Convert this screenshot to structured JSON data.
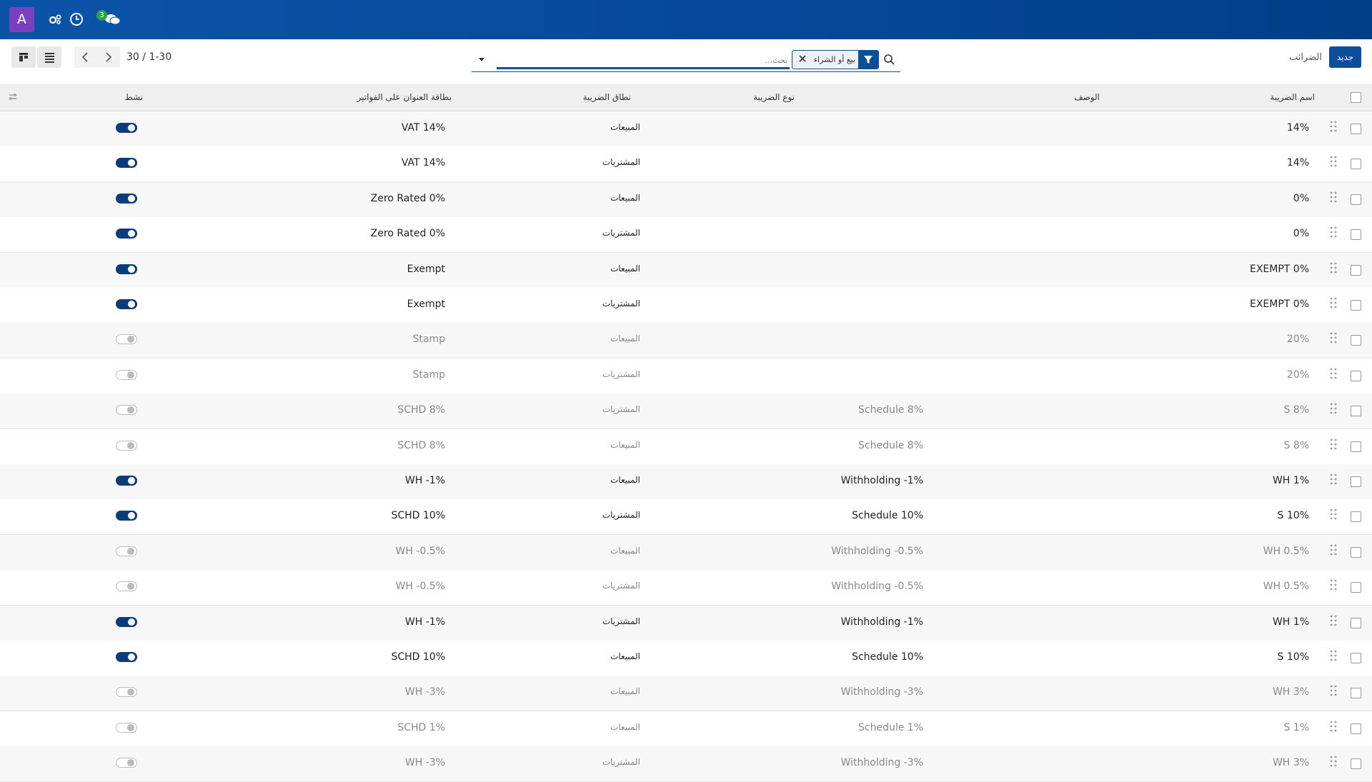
{
  "navbar": {
    "avatar_letter": "A",
    "messages_count": "3"
  },
  "control_panel": {
    "new_button": "جديد",
    "breadcrumb": "الضرائب",
    "facet_label": "بيع أو الشراء",
    "search_placeholder": "بحث...",
    "pager": "1-30 / 30"
  },
  "columns": {
    "name": "اسم الضريبة",
    "description": "الوصف",
    "type": "نوع الضريبة",
    "scope": "نطاق الضريبة",
    "invoice_label": "بطاقة العنوان على الفواتير",
    "active": "نشط"
  },
  "rows": [
    {
      "name": "14%",
      "description": "",
      "type": "المبيعات",
      "label": "VAT 14%",
      "active": true
    },
    {
      "name": "14%",
      "description": "",
      "type": "المشتريات",
      "label": "VAT 14%",
      "active": true
    },
    {
      "name": "0%",
      "description": "",
      "type": "المبيعات",
      "label": "Zero Rated 0%",
      "active": true
    },
    {
      "name": "0%",
      "description": "",
      "type": "المشتريات",
      "label": "Zero Rated 0%",
      "active": true
    },
    {
      "name": "EXEMPT 0%",
      "description": "",
      "type": "المبيعات",
      "label": "Exempt",
      "active": true
    },
    {
      "name": "EXEMPT 0%",
      "description": "",
      "type": "المشتريات",
      "label": "Exempt",
      "active": true
    },
    {
      "name": "20%",
      "description": "",
      "type": "المبيعات",
      "label": "Stamp",
      "active": false
    },
    {
      "name": "20%",
      "description": "",
      "type": "المشتريات",
      "label": "Stamp",
      "active": false
    },
    {
      "name": "S 8%",
      "description": "Schedule 8%",
      "type": "المشتريات",
      "label": "SCHD 8%",
      "active": false
    },
    {
      "name": "S 8%",
      "description": "Schedule 8%",
      "type": "المبيعات",
      "label": "SCHD 8%",
      "active": false
    },
    {
      "name": "WH 1%",
      "description": "Withholding -1%",
      "type": "المبيعات",
      "label": "WH -1%",
      "active": true
    },
    {
      "name": "S 10%",
      "description": "Schedule 10%",
      "type": "المشتريات",
      "label": "SCHD 10%",
      "active": true
    },
    {
      "name": "WH 0.5%",
      "description": "Withholding -0.5%",
      "type": "المبيعات",
      "label": "WH -0.5%",
      "active": false
    },
    {
      "name": "WH 0.5%",
      "description": "Withholding -0.5%",
      "type": "المشتريات",
      "label": "WH -0.5%",
      "active": false
    },
    {
      "name": "WH 1%",
      "description": "Withholding -1%",
      "type": "المشتريات",
      "label": "WH -1%",
      "active": true
    },
    {
      "name": "S 10%",
      "description": "Schedule 10%",
      "type": "المبيعات",
      "label": "SCHD 10%",
      "active": true
    },
    {
      "name": "WH 3%",
      "description": "Withholding -3%",
      "type": "المبيعات",
      "label": "WH -3%",
      "active": false
    },
    {
      "name": "S 1%",
      "description": "Schedule 1%",
      "type": "المبيعات",
      "label": "SCHD 1%",
      "active": false
    },
    {
      "name": "WH 3%",
      "description": "Withholding -3%",
      "type": "المشتريات",
      "label": "WH -3%",
      "active": false
    }
  ],
  "colors": {
    "brand": "#0b4f9a",
    "toggle_on": "#0b3d7a",
    "avatar": "#7b3fbf",
    "badge": "#28a745"
  }
}
